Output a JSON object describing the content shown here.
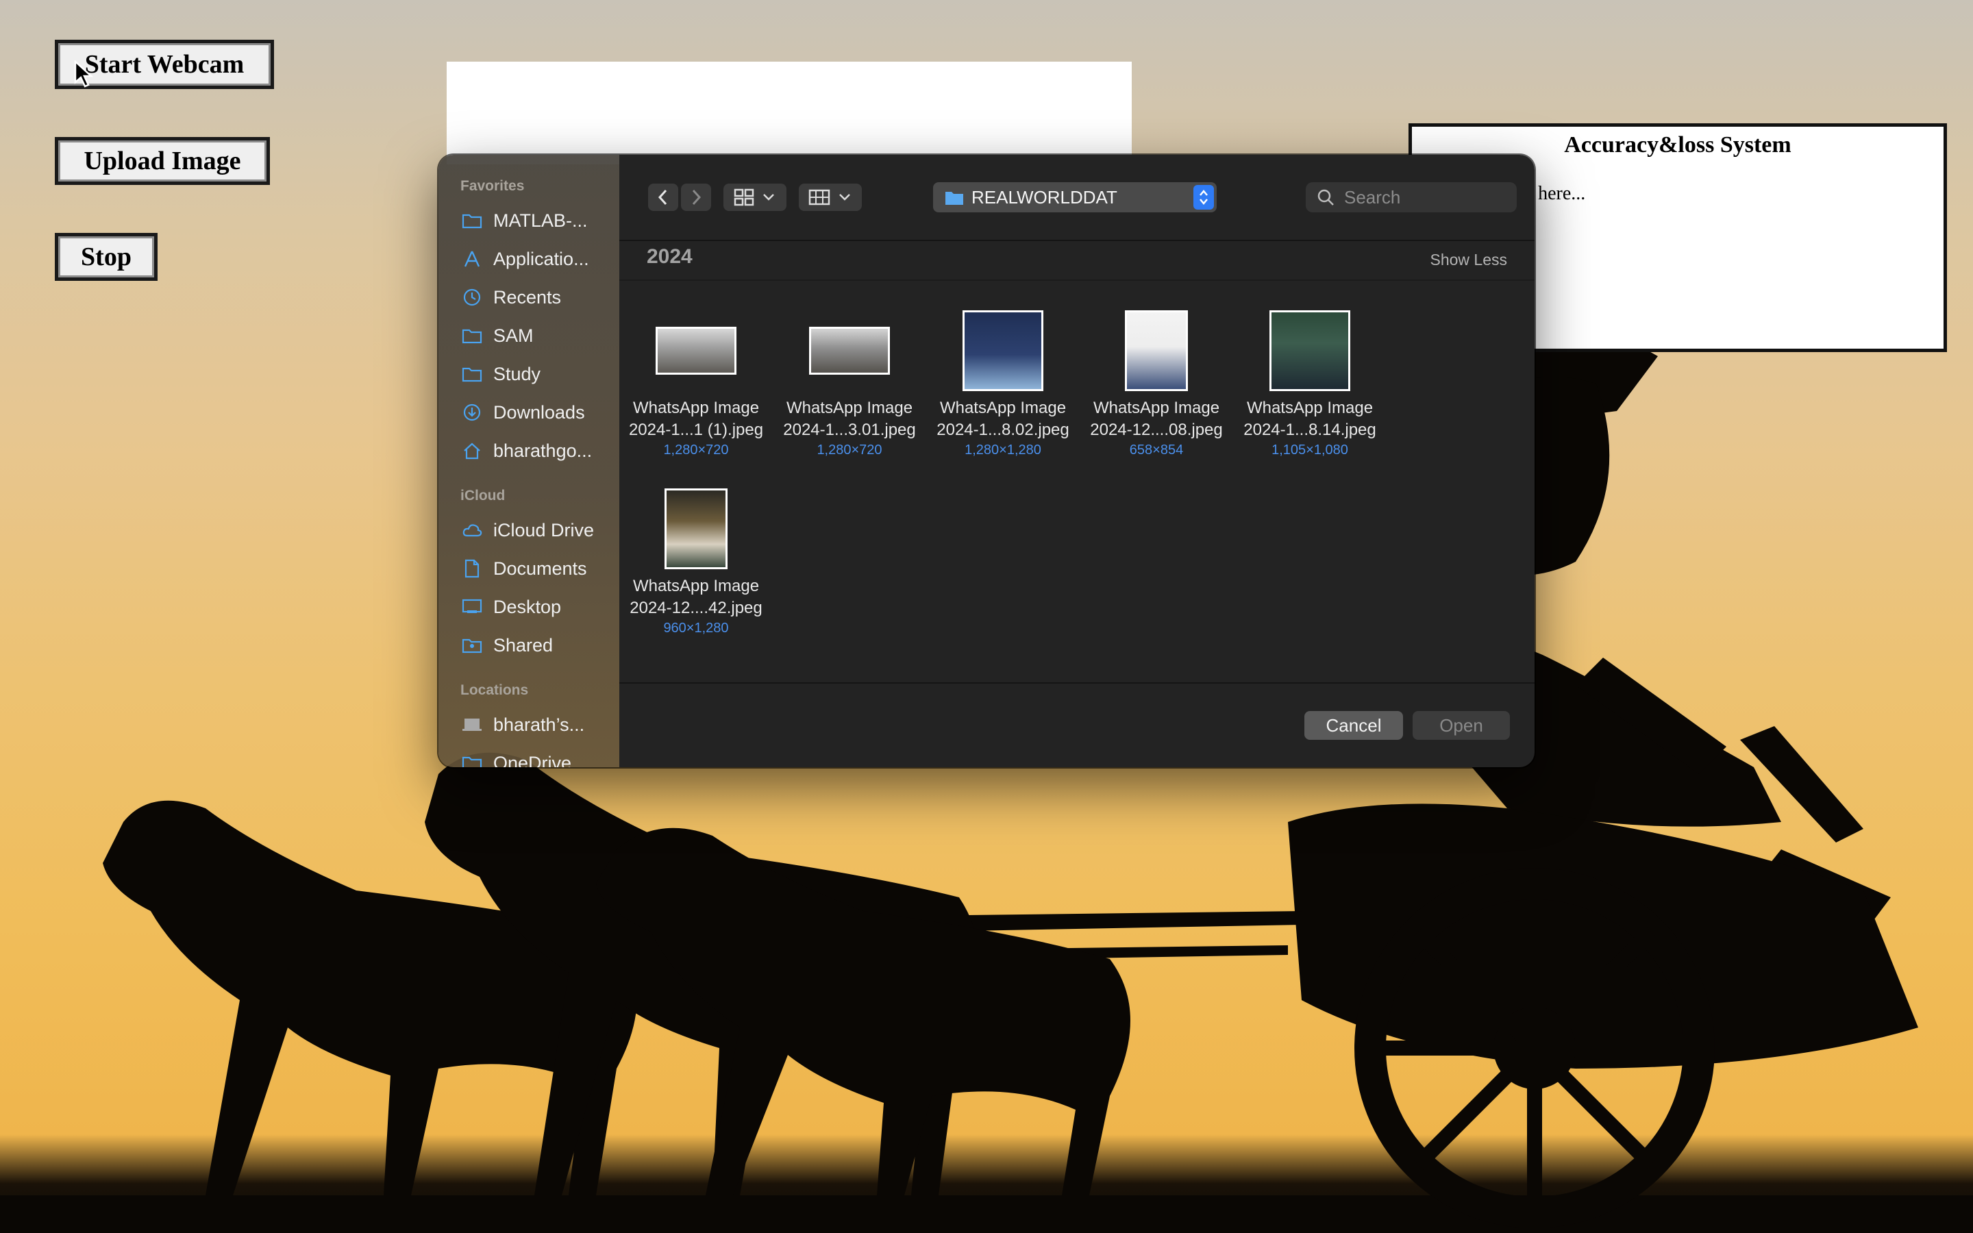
{
  "page": {
    "start_webcam": "Start Webcam",
    "upload_image": "Upload Image",
    "stop": "Stop",
    "accuracy_panel": {
      "title": "Accuracy&loss System",
      "line1": "%",
      "line2": "splay here..."
    }
  },
  "dialog": {
    "path": "REALWORLDDAT",
    "search_placeholder": "Search",
    "group_title": "2024",
    "show_less": "Show Less",
    "cancel": "Cancel",
    "open": "Open",
    "sidebar": {
      "favorites_label": "Favorites",
      "favorites": [
        {
          "label": "MATLAB-...",
          "icon": "folder-icon"
        },
        {
          "label": "Applicatio...",
          "icon": "applications-icon"
        },
        {
          "label": "Recents",
          "icon": "clock-icon"
        },
        {
          "label": "SAM",
          "icon": "folder-icon"
        },
        {
          "label": "Study",
          "icon": "folder-icon"
        },
        {
          "label": "Downloads",
          "icon": "download-icon"
        },
        {
          "label": "bharathgo...",
          "icon": "home-icon"
        }
      ],
      "icloud_label": "iCloud",
      "icloud": [
        {
          "label": "iCloud Drive",
          "icon": "cloud-icon"
        },
        {
          "label": "Documents",
          "icon": "document-icon"
        },
        {
          "label": "Desktop",
          "icon": "desktop-icon"
        },
        {
          "label": "Shared",
          "icon": "shared-folder-icon"
        }
      ],
      "locations_label": "Locations",
      "locations": [
        {
          "label": "bharath’s...",
          "icon": "laptop-icon"
        },
        {
          "label": "OneDrive",
          "icon": "folder-icon"
        }
      ]
    },
    "files": [
      {
        "name1": "WhatsApp Image",
        "name2": "2024-1...1 (1).jpeg",
        "dims": "1,280×720"
      },
      {
        "name1": "WhatsApp Image",
        "name2": "2024-1...3.01.jpeg",
        "dims": "1,280×720"
      },
      {
        "name1": "WhatsApp Image",
        "name2": "2024-1...8.02.jpeg",
        "dims": "1,280×1,280"
      },
      {
        "name1": "WhatsApp Image",
        "name2": "2024-12....08.jpeg",
        "dims": "658×854"
      },
      {
        "name1": "WhatsApp Image",
        "name2": "2024-1...8.14.jpeg",
        "dims": "1,105×1,080"
      },
      {
        "name1": "WhatsApp Image",
        "name2": "2024-12....42.jpeg",
        "dims": "960×1,280"
      }
    ]
  },
  "colors": {
    "accent": "#2f7bf5",
    "dims_text": "#4b90ec",
    "sidebar_icon": "#4aa3f0"
  }
}
